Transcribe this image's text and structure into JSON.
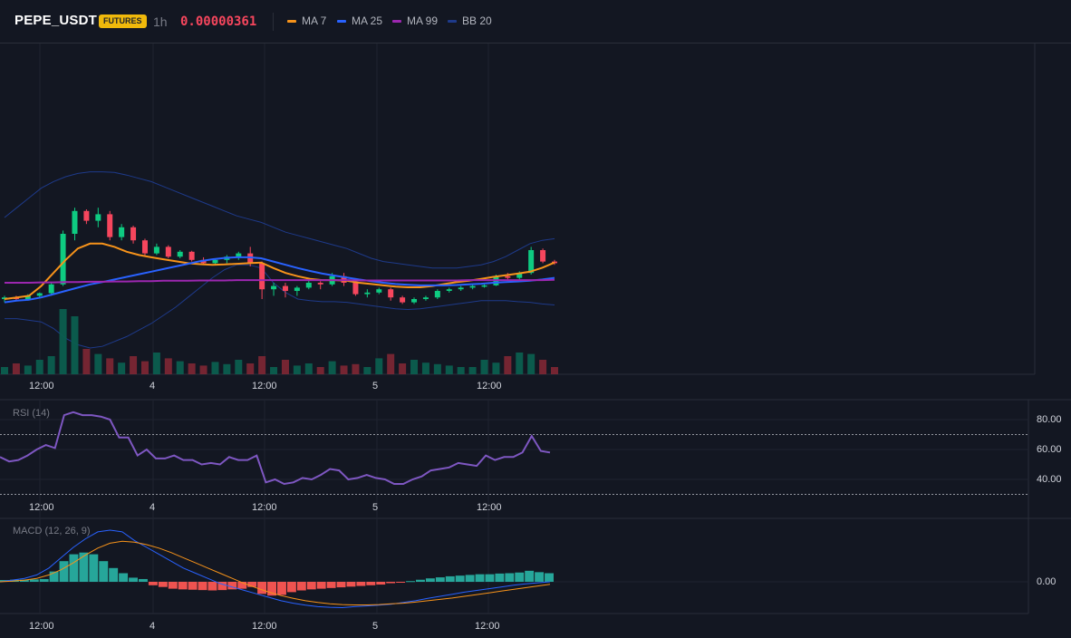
{
  "header": {
    "symbol": "PEPE_USDT",
    "badge": "FUTURES",
    "interval": "1h",
    "price": "0.00000361"
  },
  "legend": [
    {
      "label": "MA 7",
      "color": "#f7931a"
    },
    {
      "label": "MA 25",
      "color": "#2962ff"
    },
    {
      "label": "MA 99",
      "color": "#9c27b0"
    },
    {
      "label": "BB 20",
      "color": "#1e3a8a"
    }
  ],
  "colors": {
    "up": "#0ecb81",
    "down": "#f6465d",
    "background": "#131722",
    "grid": "#1f2330",
    "rsi": "#7e57c2",
    "macd": "#2962ff",
    "signal": "#f7931a",
    "hist_up": "#26a69a",
    "hist_down": "#ef5350"
  },
  "time_axis": [
    "12:00",
    "4",
    "12:00",
    "5",
    "12:00"
  ],
  "rsi": {
    "label": "RSI (14)",
    "ticks": [
      "80.00",
      "60.00",
      "40.00"
    ]
  },
  "macd": {
    "label": "MACD (12, 26, 9)",
    "ticks": [
      "0.00"
    ]
  },
  "chart_data": [
    {
      "type": "candlestick",
      "series": [
        {
          "name": "MA 7",
          "values": [
            2.5,
            2.55,
            2.6,
            2.9,
            3.3,
            3.7,
            4.05,
            4.2,
            4.2,
            4.1,
            3.95,
            3.85,
            3.78,
            3.72,
            3.66,
            3.6,
            3.57,
            3.55,
            3.56,
            3.58,
            3.6,
            3.62,
            3.45,
            3.3,
            3.2,
            3.12,
            3.08,
            3.08,
            3.06,
            3.0,
            2.96,
            2.92,
            2.88,
            2.86,
            2.86,
            2.9,
            2.96,
            3.02,
            3.06,
            3.12,
            3.18,
            3.23,
            3.28,
            3.34,
            3.46,
            3.62
          ]
        },
        {
          "name": "MA 25",
          "values": [
            2.4,
            2.45,
            2.48,
            2.55,
            2.65,
            2.75,
            2.85,
            2.95,
            3.02,
            3.1,
            3.18,
            3.26,
            3.34,
            3.42,
            3.5,
            3.58,
            3.66,
            3.72,
            3.76,
            3.78,
            3.78,
            3.75,
            3.65,
            3.55,
            3.45,
            3.36,
            3.28,
            3.22,
            3.16,
            3.1,
            3.05,
            3.0,
            2.96,
            2.94,
            2.92,
            2.92,
            2.92,
            2.93,
            2.95,
            2.97,
            3.0,
            3.02,
            3.04,
            3.06,
            3.1,
            3.15
          ]
        },
        {
          "name": "MA 99",
          "values": [
            3.0,
            3.0,
            3.0,
            3.01,
            3.01,
            3.02,
            3.02,
            3.03,
            3.03,
            3.04,
            3.04,
            3.05,
            3.05,
            3.06,
            3.06,
            3.06,
            3.07,
            3.07,
            3.07,
            3.08,
            3.08,
            3.08,
            3.08,
            3.08,
            3.08,
            3.08,
            3.08,
            3.08,
            3.08,
            3.07,
            3.07,
            3.07,
            3.07,
            3.07,
            3.07,
            3.07,
            3.07,
            3.07,
            3.08,
            3.08,
            3.08,
            3.08,
            3.08,
            3.08,
            3.08,
            3.09
          ]
        }
      ],
      "candles": [
        [
          2.5,
          2.6,
          2.4,
          2.55
        ],
        [
          2.55,
          2.6,
          2.45,
          2.5
        ],
        [
          2.5,
          2.65,
          2.45,
          2.6
        ],
        [
          2.6,
          2.7,
          2.55,
          2.68
        ],
        [
          2.68,
          3.0,
          2.6,
          2.95
        ],
        [
          2.95,
          4.6,
          2.9,
          4.5
        ],
        [
          4.5,
          5.3,
          4.3,
          5.2
        ],
        [
          5.2,
          5.25,
          4.8,
          4.9
        ],
        [
          4.9,
          5.3,
          4.7,
          5.1
        ],
        [
          5.1,
          5.2,
          4.3,
          4.4
        ],
        [
          4.4,
          4.8,
          4.3,
          4.7
        ],
        [
          4.7,
          4.75,
          4.2,
          4.3
        ],
        [
          4.3,
          4.35,
          3.8,
          3.9
        ],
        [
          3.9,
          4.2,
          3.85,
          4.1
        ],
        [
          4.1,
          4.15,
          3.75,
          3.8
        ],
        [
          3.8,
          4.0,
          3.75,
          3.95
        ],
        [
          3.95,
          3.98,
          3.65,
          3.7
        ],
        [
          3.7,
          3.78,
          3.55,
          3.6
        ],
        [
          3.6,
          3.75,
          3.55,
          3.7
        ],
        [
          3.7,
          3.85,
          3.6,
          3.8
        ],
        [
          3.8,
          3.95,
          3.7,
          3.9
        ],
        [
          3.9,
          4.1,
          3.5,
          3.6
        ],
        [
          3.6,
          3.65,
          2.5,
          2.8
        ],
        [
          2.8,
          3.0,
          2.6,
          2.9
        ],
        [
          2.9,
          3.0,
          2.55,
          2.75
        ],
        [
          2.75,
          2.9,
          2.6,
          2.85
        ],
        [
          2.85,
          3.1,
          2.8,
          3.0
        ],
        [
          3.0,
          3.05,
          2.8,
          2.95
        ],
        [
          2.95,
          3.3,
          2.9,
          3.2
        ],
        [
          3.2,
          3.3,
          2.9,
          3.0
        ],
        [
          3.0,
          3.05,
          2.6,
          2.65
        ],
        [
          2.65,
          2.8,
          2.55,
          2.7
        ],
        [
          2.7,
          2.85,
          2.65,
          2.8
        ],
        [
          2.8,
          2.85,
          2.45,
          2.55
        ],
        [
          2.55,
          2.6,
          2.35,
          2.4
        ],
        [
          2.4,
          2.55,
          2.35,
          2.5
        ],
        [
          2.5,
          2.6,
          2.45,
          2.55
        ],
        [
          2.55,
          2.8,
          2.5,
          2.75
        ],
        [
          2.75,
          2.85,
          2.7,
          2.8
        ],
        [
          2.8,
          2.9,
          2.75,
          2.85
        ],
        [
          2.85,
          2.95,
          2.8,
          2.9
        ],
        [
          2.9,
          2.95,
          2.85,
          2.92
        ],
        [
          2.92,
          3.25,
          2.9,
          3.2
        ],
        [
          3.2,
          3.3,
          3.1,
          3.15
        ],
        [
          3.15,
          3.35,
          3.1,
          3.3
        ],
        [
          3.3,
          4.1,
          3.25,
          4.0
        ],
        [
          4.0,
          4.05,
          3.6,
          3.65
        ],
        [
          3.65,
          3.7,
          3.55,
          3.6
        ]
      ],
      "bb_upper": [
        5.0,
        5.3,
        5.6,
        5.9,
        6.1,
        6.25,
        6.35,
        6.4,
        6.4,
        6.38,
        6.3,
        6.2,
        6.1,
        5.95,
        5.8,
        5.65,
        5.5,
        5.35,
        5.2,
        5.05,
        4.95,
        4.85,
        4.7,
        4.55,
        4.45,
        4.35,
        4.25,
        4.15,
        4.05,
        3.9,
        3.75,
        3.65,
        3.6,
        3.55,
        3.5,
        3.45,
        3.45,
        3.45,
        3.5,
        3.55,
        3.65,
        3.8,
        4.0,
        4.2,
        4.3,
        4.35
      ],
      "bb_lower": [
        1.9,
        1.9,
        1.85,
        1.8,
        1.6,
        1.3,
        1.1,
        1.0,
        1.05,
        1.2,
        1.35,
        1.55,
        1.75,
        2.0,
        2.25,
        2.55,
        2.85,
        3.15,
        3.4,
        3.55,
        3.55,
        3.45,
        3.0,
        2.7,
        2.5,
        2.45,
        2.42,
        2.42,
        2.4,
        2.35,
        2.3,
        2.25,
        2.2,
        2.18,
        2.2,
        2.25,
        2.3,
        2.35,
        2.4,
        2.45,
        2.45,
        2.45,
        2.42,
        2.4,
        2.35,
        2.32
      ],
      "volume": [
        10,
        15,
        12,
        20,
        25,
        90,
        80,
        35,
        28,
        22,
        16,
        25,
        18,
        30,
        22,
        18,
        15,
        12,
        17,
        14,
        20,
        15,
        25,
        10,
        20,
        12,
        15,
        10,
        18,
        12,
        14,
        10,
        22,
        28,
        15,
        20,
        16,
        14,
        12,
        10,
        10,
        20,
        16,
        25,
        30,
        28,
        20,
        10
      ]
    },
    {
      "type": "line",
      "series": [
        {
          "name": "RSI (14)",
          "values": [
            55,
            52,
            53,
            56,
            60,
            63,
            61,
            83,
            85,
            83,
            83,
            82,
            80,
            68,
            68,
            56,
            60,
            54,
            54,
            56,
            53,
            53,
            50,
            51,
            50,
            55,
            53,
            53,
            56,
            38,
            40,
            37,
            38,
            41,
            40,
            43,
            47,
            46,
            40,
            41,
            43,
            41,
            40,
            37,
            37,
            40,
            42,
            46,
            47,
            48,
            51,
            50,
            49,
            56,
            53,
            55,
            55,
            58,
            69,
            59,
            58
          ]
        }
      ],
      "ylim": [
        30,
        90
      ],
      "reference_lines": [
        70,
        30
      ]
    },
    {
      "type": "bar",
      "series": [
        {
          "name": "MACD",
          "values": [
            0,
            0.05,
            0.1,
            0.2,
            0.4,
            0.7,
            1.0,
            1.25,
            1.45,
            1.5,
            1.45,
            1.2,
            1.0,
            0.8,
            0.6,
            0.4,
            0.25,
            0.1,
            -0.05,
            -0.15,
            -0.25,
            -0.35,
            -0.45,
            -0.55,
            -0.62,
            -0.68,
            -0.72,
            -0.74,
            -0.75,
            -0.72,
            -0.7,
            -0.68,
            -0.65,
            -0.6,
            -0.55,
            -0.48,
            -0.42,
            -0.36,
            -0.3,
            -0.25,
            -0.2,
            -0.15,
            -0.1,
            -0.06,
            -0.03,
            0.0
          ]
        },
        {
          "name": "Signal",
          "values": [
            0,
            0.02,
            0.05,
            0.1,
            0.2,
            0.35,
            0.55,
            0.78,
            0.98,
            1.12,
            1.18,
            1.15,
            1.08,
            0.98,
            0.85,
            0.7,
            0.55,
            0.4,
            0.25,
            0.1,
            -0.05,
            -0.18,
            -0.3,
            -0.4,
            -0.48,
            -0.55,
            -0.6,
            -0.64,
            -0.66,
            -0.67,
            -0.67,
            -0.66,
            -0.64,
            -0.62,
            -0.59,
            -0.55,
            -0.51,
            -0.47,
            -0.42,
            -0.37,
            -0.32,
            -0.27,
            -0.22,
            -0.17,
            -0.12,
            -0.07
          ]
        },
        {
          "name": "Histogram",
          "values": [
            0.05,
            0.06,
            0.06,
            0.07,
            0.08,
            0.3,
            0.6,
            0.8,
            0.85,
            0.8,
            0.6,
            0.4,
            0.25,
            0.12,
            0.08,
            -0.1,
            -0.15,
            -0.2,
            -0.22,
            -0.23,
            -0.24,
            -0.25,
            -0.24,
            -0.22,
            -0.2,
            -0.15,
            -0.35,
            -0.4,
            -0.38,
            -0.3,
            -0.25,
            -0.22,
            -0.2,
            -0.18,
            -0.16,
            -0.14,
            -0.12,
            -0.1,
            -0.08,
            -0.04,
            -0.02,
            0.02,
            0.06,
            0.1,
            0.13,
            0.16,
            0.18,
            0.2,
            0.22,
            0.22,
            0.24,
            0.25,
            0.27,
            0.32,
            0.28,
            0.25
          ]
        }
      ]
    }
  ]
}
